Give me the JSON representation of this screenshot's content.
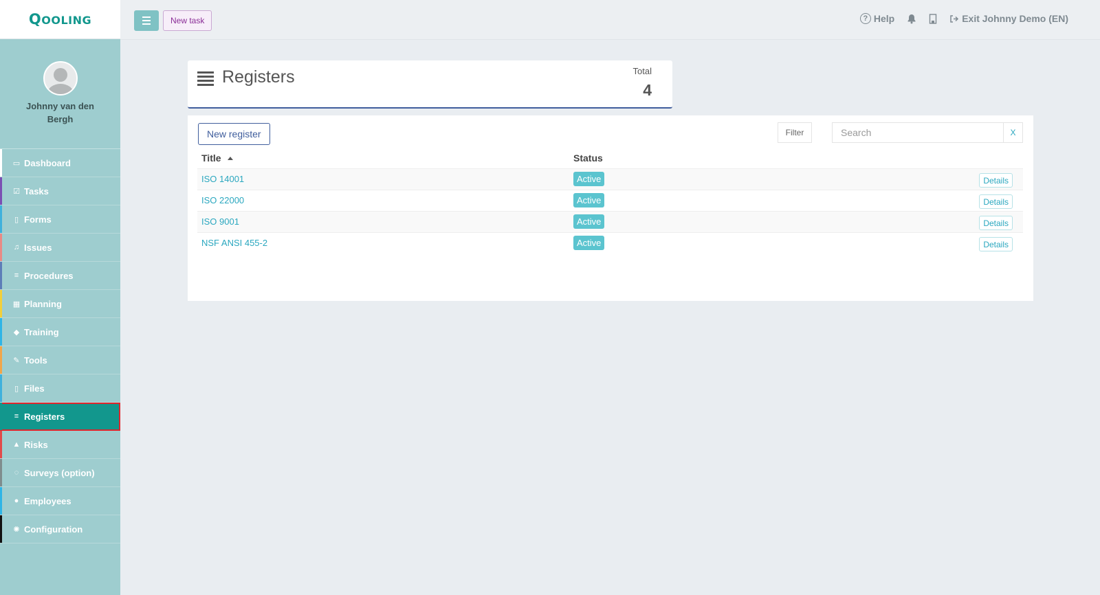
{
  "app": {
    "logo": "Qooling"
  },
  "profile": {
    "name": "Johnny van den Bergh"
  },
  "sidebar": {
    "items": [
      {
        "label": "Dashboard",
        "icon": "monitor-icon",
        "glyph": "▭",
        "stripe": "#ffffff"
      },
      {
        "label": "Tasks",
        "icon": "check-square-icon",
        "glyph": "☑",
        "stripe": "#7b4fb3"
      },
      {
        "label": "Forms",
        "icon": "file-icon",
        "glyph": "▯",
        "stripe": "#3fb1dc"
      },
      {
        "label": "Issues",
        "icon": "bell-icon",
        "glyph": "♫",
        "stripe": "#e98a85"
      },
      {
        "label": "Procedures",
        "icon": "list-icon",
        "glyph": "≡",
        "stripe": "#5d7db8"
      },
      {
        "label": "Planning",
        "icon": "calendar-icon",
        "glyph": "▦",
        "stripe": "#f2cf3a"
      },
      {
        "label": "Training",
        "icon": "graduation-cap-icon",
        "glyph": "◆",
        "stripe": "#2fb5e6"
      },
      {
        "label": "Tools",
        "icon": "wrench-icon",
        "glyph": "✎",
        "stripe": "#f0a64b"
      },
      {
        "label": "Files",
        "icon": "pdf-file-icon",
        "glyph": "▯",
        "stripe": "#3fb1dc"
      },
      {
        "label": "Registers",
        "icon": "list-icon",
        "glyph": "≡",
        "stripe": "#12978d",
        "active": true
      },
      {
        "label": "Risks",
        "icon": "warning-icon",
        "glyph": "▲",
        "stripe": "#e24a4a"
      },
      {
        "label": "Surveys (option)",
        "icon": "comment-icon",
        "glyph": "◌",
        "stripe": "#7f8c8d"
      },
      {
        "label": "Employees",
        "icon": "users-icon",
        "glyph": "●",
        "stripe": "#2fb5e6"
      },
      {
        "label": "Configuration",
        "icon": "gear-icon",
        "glyph": "✺",
        "stripe": "#111111"
      }
    ]
  },
  "topbar": {
    "new_task_label": "New task",
    "help_label": "Help",
    "exit_label": "Exit Johnny Demo (EN)"
  },
  "header": {
    "title": "Registers",
    "total_label": "Total",
    "total_value": "4"
  },
  "table": {
    "new_register_label": "New register",
    "filter_label": "Filter",
    "search_placeholder": "Search",
    "clear_label": "X",
    "columns": {
      "title": "Title",
      "status": "Status"
    },
    "details_label": "Details",
    "rows": [
      {
        "title": "ISO 14001",
        "status": "Active"
      },
      {
        "title": "ISO 22000",
        "status": "Active"
      },
      {
        "title": "ISO 9001",
        "status": "Active"
      },
      {
        "title": "NSF ANSI 455-2",
        "status": "Active"
      }
    ]
  },
  "colors": {
    "accent": "#12978d",
    "sidebar_bg": "#9ecdcf",
    "link": "#2aa7bf",
    "badge": "#5bc4cf",
    "header_border": "#3f5d9c"
  }
}
